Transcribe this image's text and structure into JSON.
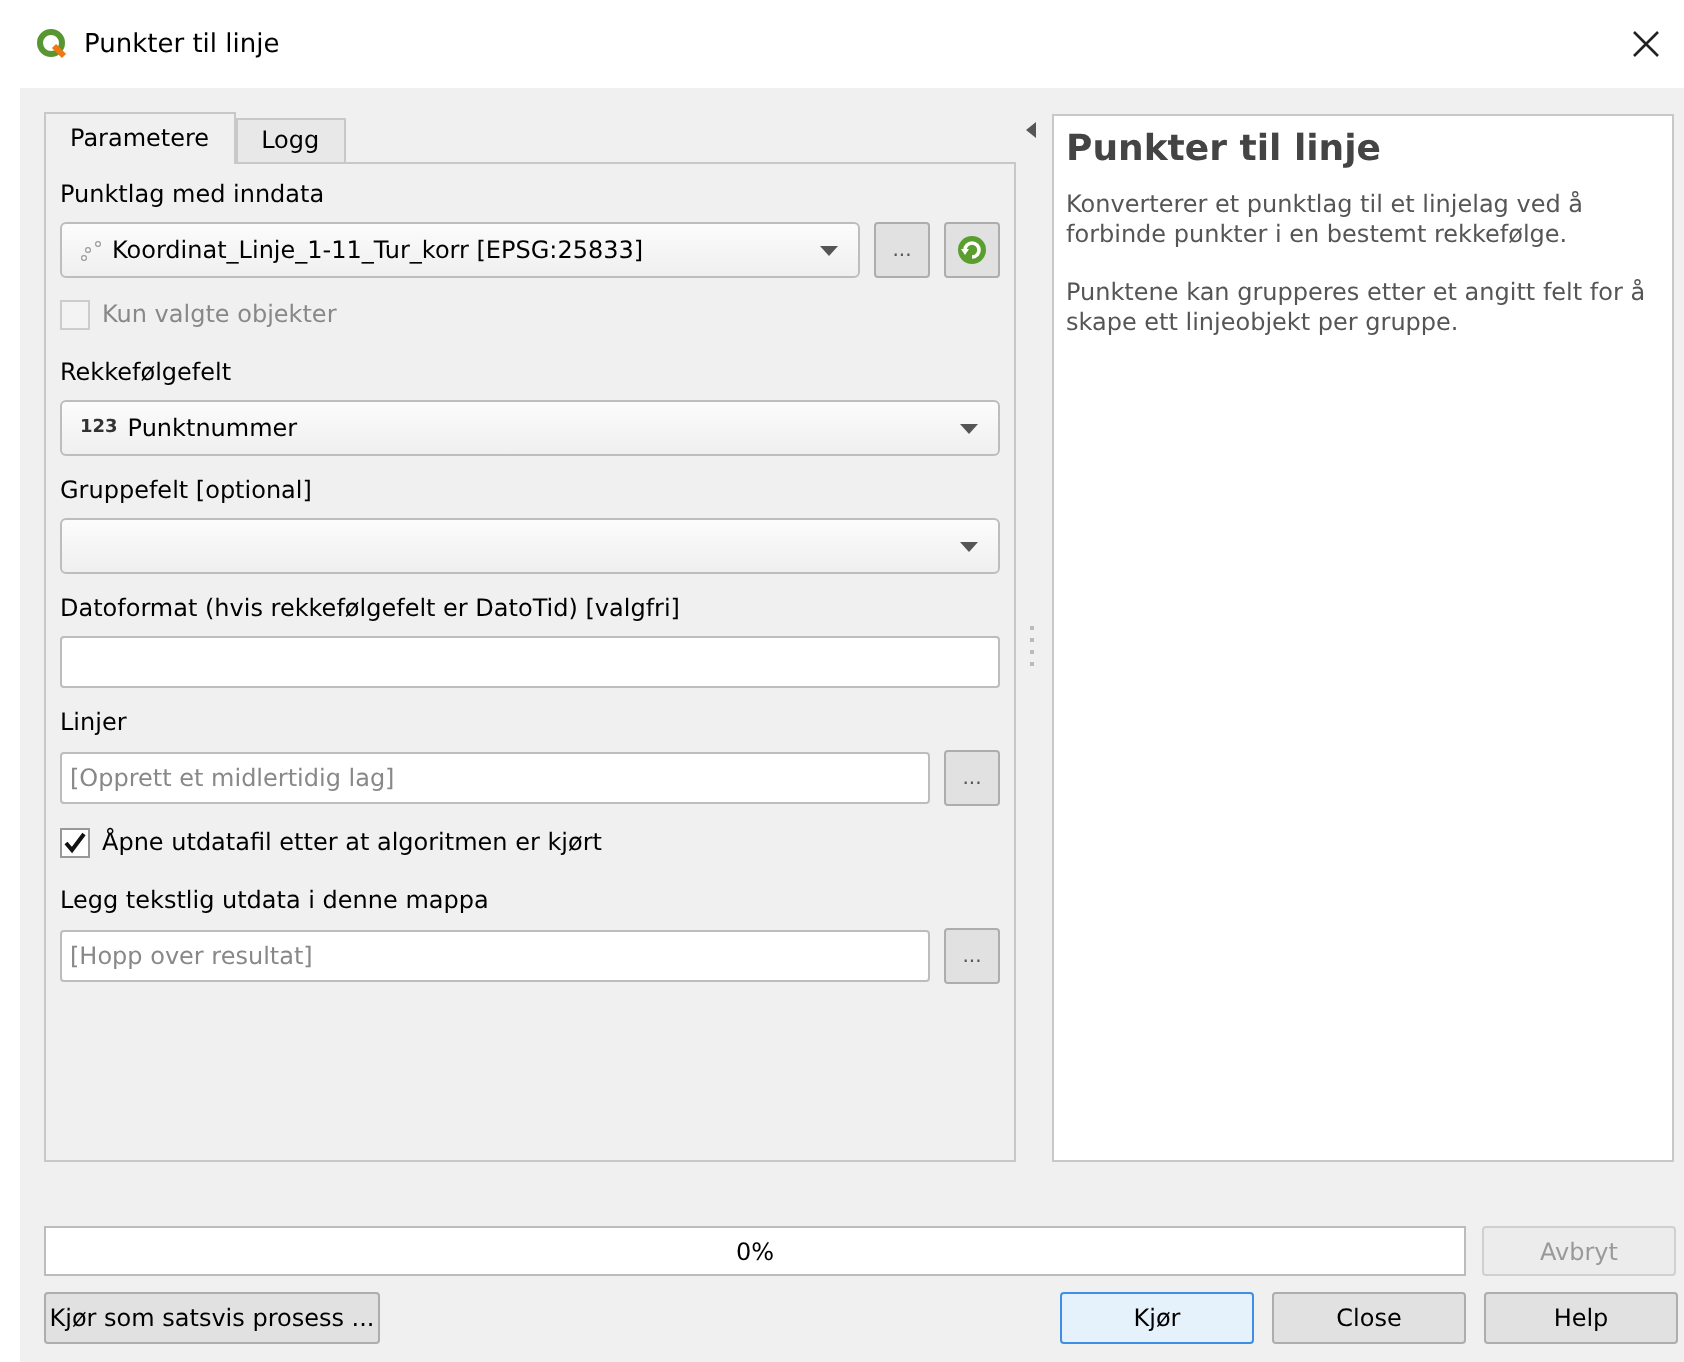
{
  "window": {
    "title": "Punkter til linje"
  },
  "tabs": [
    {
      "label": "Parametere",
      "selected": true
    },
    {
      "label": "Logg",
      "selected": false
    }
  ],
  "parameters": [
    {
      "kind": "layer_combo",
      "label": "Punktlag med inndata",
      "value": "Koordinat_Linje_1-11_Tur_korr [EPSG:25833]",
      "browse": "..."
    },
    {
      "kind": "checkbox",
      "label": "Kun valgte objekter",
      "checked": false,
      "disabled": true
    },
    {
      "kind": "combo",
      "label": "Rekkefølgefelt",
      "value": "Punktnummer",
      "icon_text": "123"
    },
    {
      "kind": "combo",
      "label": "Gruppefelt [optional]"
    },
    {
      "kind": "text",
      "label": "Datoformat (hvis rekkefølgefelt er DatoTid) [valgfri]"
    },
    {
      "kind": "file",
      "label": "Linjer",
      "placeholder": "[Opprett et midlertidig lag]",
      "browse": "..."
    },
    {
      "kind": "checkbox",
      "label": "Åpne utdatafil etter at algoritmen er kjørt",
      "checked": true,
      "disabled": false
    },
    {
      "kind": "file",
      "label": "Legg tekstlig utdata i denne mappa",
      "placeholder": "[Hopp over resultat]",
      "browse": "..."
    }
  ],
  "help": {
    "title": "Punkter til linje",
    "paragraphs": [
      "Konverterer et punktlag til et linjelag ved å forbinde punkter i en bestemt rekkefølge.",
      "Punktene kan grupperes etter et angitt felt for å skape ett linjeobjekt per gruppe."
    ]
  },
  "progress": {
    "level": 0,
    "reading": "0%"
  },
  "cancel_button": {
    "label": "Avbryt",
    "disabled": true
  },
  "batch_button": "Kjør som satsvis prosess ...",
  "buttons": [
    {
      "label": "Kjør",
      "default": true
    },
    {
      "label": "Close",
      "default": false
    },
    {
      "label": "Help",
      "default": false
    }
  ]
}
